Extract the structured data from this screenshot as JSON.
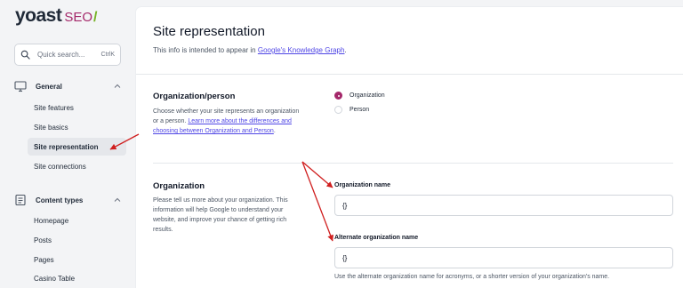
{
  "logo": {
    "brand": "yoast",
    "product": "SEO",
    "slash": "/"
  },
  "search": {
    "placeholder": "Quick search...",
    "shortcut": "CtrlK"
  },
  "sidebar": {
    "general": {
      "label": "General",
      "items": [
        "Site features",
        "Site basics",
        "Site representation",
        "Site connections"
      ],
      "active_index": 2
    },
    "content_types": {
      "label": "Content types",
      "items": [
        "Homepage",
        "Posts",
        "Pages",
        "Casino Table"
      ]
    }
  },
  "main": {
    "title": "Site representation",
    "intro_prefix": "This info is intended to appear in ",
    "intro_link": "Google's Knowledge Graph",
    "intro_suffix": ".",
    "org_person": {
      "title": "Organization/person",
      "desc_text": "Choose whether your site represents an organization or a person. ",
      "desc_link": "Learn more about the differences and choosing between Organization and Person",
      "desc_suffix": ".",
      "options": [
        "Organization",
        "Person"
      ],
      "selected": "Organization"
    },
    "organization": {
      "title": "Organization",
      "desc": "Please tell us more about your organization. This information will help Google to understand your website, and improve your chance of getting rich results.",
      "name_label": "Organization name",
      "name_value": "{}",
      "alt_label": "Alternate organization name",
      "alt_value": "{}",
      "alt_help": "Use the alternate organization name for acronyms, or a shorter version of your organization's name."
    }
  },
  "colors": {
    "brand": "#a4286a",
    "accent": "#77b227",
    "link": "#4f46e5",
    "annotation": "#d01f1f"
  }
}
